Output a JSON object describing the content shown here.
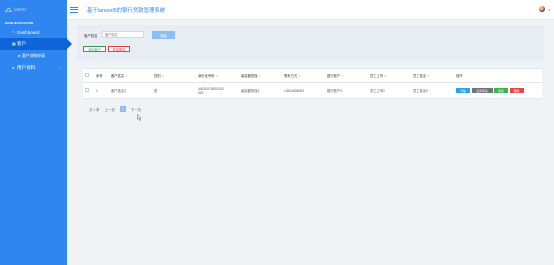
{
  "sidebar": {
    "logo_text": "CREPY",
    "section_title": "MAIN NAVIGATION",
    "items": [
      {
        "label": "Dashboard",
        "icon": "home-icon"
      },
      {
        "label": "客户",
        "icon": "table-icon",
        "active": true
      },
      {
        "label": "客户贷款申请",
        "icon": "user-icon"
      },
      {
        "label": "用户资料",
        "icon": "user-icon",
        "has_submenu": true
      }
    ]
  },
  "header": {
    "title": "基于laravel5的银行贷款管理系统"
  },
  "search": {
    "label": "客户姓名",
    "placeholder": "客户姓名",
    "value": "",
    "query_label": "搜索"
  },
  "toolbar": {
    "add_label": "添加客户",
    "bulk_delete_label": "批量删除"
  },
  "table": {
    "columns": [
      "序号",
      "客户姓名",
      "性别",
      "身份证号码",
      "最高额担保",
      "联系方式",
      "银行账户",
      "员工工号",
      "员工姓名",
      "操作"
    ],
    "rows": [
      {
        "no": "1",
        "name": "客户姓名3",
        "gender": "男",
        "id_line1": "44032019920202",
        "id_line2": "002",
        "guarantee": "最高额担保2",
        "phone": "13613696002",
        "bank": "银行账户3",
        "emp_no": "员工工号2",
        "emp_name": "员工姓名2"
      }
    ],
    "actions": {
      "detail": "详情",
      "apply": "贷款申请",
      "edit": "修改",
      "delete": "删除"
    }
  },
  "pagination": {
    "total": "共 1 条",
    "prev": "上一页",
    "current": "1",
    "next": "下一页"
  },
  "colors": {
    "sidebar": "#2f86f0",
    "active": "#0c66da",
    "detail": "#2aa1e8",
    "apply": "#6e7579",
    "edit": "#38b64a",
    "delete": "#e5484a"
  }
}
